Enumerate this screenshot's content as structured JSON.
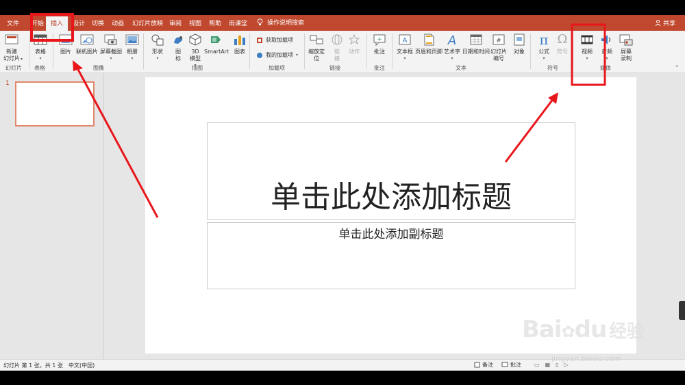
{
  "tabs": [
    "文件",
    "开始",
    "插入",
    "设计",
    "切换",
    "动画",
    "幻灯片放映",
    "审阅",
    "视图",
    "帮助",
    "雨课堂"
  ],
  "tell_me": "操作说明搜索",
  "share": "共享",
  "ribbon": {
    "new_slide": "新建\n幻灯片",
    "table": "表格",
    "picture": "图片",
    "online_picture": "联机图片",
    "screenshot": "屏幕截图",
    "album": "相册",
    "shapes": "形状",
    "icons": "图\n标",
    "model3d": "3D\n模型",
    "smartart": "SmartArt",
    "chart": "图表",
    "get_addins": "获取加载项",
    "my_addins": "我的加载项",
    "zoom": "缩放定\n位",
    "link": "链\n接",
    "action": "动作",
    "comment": "批注",
    "textbox": "文本框",
    "header_footer": "页眉和页脚",
    "wordart": "艺术字",
    "datetime": "日期和时间",
    "slide_number": "幻灯片\n编号",
    "object": "对象",
    "equation": "公式",
    "symbol": "符号",
    "video": "视频",
    "audio": "音频",
    "screen_recording": "屏幕\n录制"
  },
  "groups": {
    "slides": "幻灯片",
    "tables": "表格",
    "images": "图像",
    "illustrations": "插图",
    "addins": "加载项",
    "links": "链接",
    "comments": "批注",
    "text": "文本",
    "symbols": "符号",
    "media": "媒体"
  },
  "thumbnail_number": "1",
  "slide": {
    "title": "单击此处添加标题",
    "subtitle": "单击此处添加副标题"
  },
  "status": {
    "slide_info": "幻灯片 第 1 张，共 1 张",
    "language": "中文(中国)",
    "notes": "备注",
    "comments": "批注"
  },
  "watermark": {
    "main": "Bai",
    "main2": "du",
    "cn": "经验",
    "url": "jingyan.baidu.com"
  },
  "colors": {
    "tab_bar": "#c0482e",
    "annotation": "#e8161b"
  }
}
